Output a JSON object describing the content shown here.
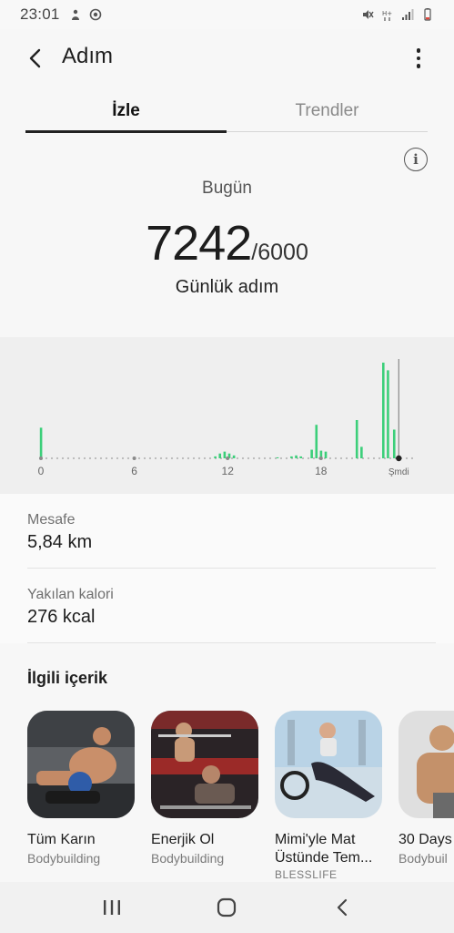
{
  "status_bar": {
    "time": "23:01",
    "left_icons": [
      "usb-icon",
      "sync-icon"
    ],
    "right_icons": [
      "mute-icon",
      "data-icon",
      "signal-icon",
      "battery-icon"
    ]
  },
  "header": {
    "title": "Adım",
    "back_icon": "back-arrow-icon",
    "more_icon": "more-vertical-icon"
  },
  "tabs": [
    {
      "label": "İzle",
      "active": true
    },
    {
      "label": "Trendler",
      "active": false
    }
  ],
  "summary": {
    "period_label": "Bugün",
    "steps": "7242",
    "goal": "/6000",
    "steps_label": "Günlük adım",
    "info_icon": "info-icon"
  },
  "chart_data": {
    "type": "bar",
    "x_ticks": [
      "0",
      "6",
      "12",
      "18",
      "Şmdi"
    ],
    "hourly_values": [
      {
        "hour": 0.0,
        "value": 32
      },
      {
        "hour": 11.2,
        "value": 2
      },
      {
        "hour": 11.5,
        "value": 5
      },
      {
        "hour": 11.8,
        "value": 7
      },
      {
        "hour": 12.1,
        "value": 5
      },
      {
        "hour": 12.4,
        "value": 3
      },
      {
        "hour": 15.2,
        "value": 1
      },
      {
        "hour": 16.1,
        "value": 2
      },
      {
        "hour": 16.4,
        "value": 3
      },
      {
        "hour": 16.7,
        "value": 2
      },
      {
        "hour": 17.4,
        "value": 9
      },
      {
        "hour": 17.7,
        "value": 35
      },
      {
        "hour": 18.0,
        "value": 8
      },
      {
        "hour": 18.3,
        "value": 7
      },
      {
        "hour": 20.3,
        "value": 40
      },
      {
        "hour": 20.6,
        "value": 12
      },
      {
        "hour": 22.0,
        "value": 100
      },
      {
        "hour": 22.3,
        "value": 92
      },
      {
        "hour": 22.7,
        "value": 30
      }
    ],
    "now_hour": 23.0,
    "bar_color": "#3ccf7a"
  },
  "stats": [
    {
      "label": "Mesafe",
      "value": "5,84 km"
    },
    {
      "label": "Yakılan kalori",
      "value": "276 kcal"
    }
  ],
  "related": {
    "title": "İlgili içerik",
    "cards": [
      {
        "title": "Tüm Karın",
        "subtitle": "Bodybuilding",
        "extra": ""
      },
      {
        "title": "Enerjik Ol",
        "subtitle": "Bodybuilding",
        "extra": ""
      },
      {
        "title": "Mimi'yle Mat",
        "title2": "Üstünde Tem...",
        "subtitle": "",
        "extra": "BLESSLIFE"
      },
      {
        "title": "30 Days",
        "subtitle": "Bodybuil",
        "extra": ""
      }
    ]
  },
  "nav_bar": {
    "icons": [
      "recent-apps-icon",
      "home-icon",
      "back-icon"
    ]
  }
}
